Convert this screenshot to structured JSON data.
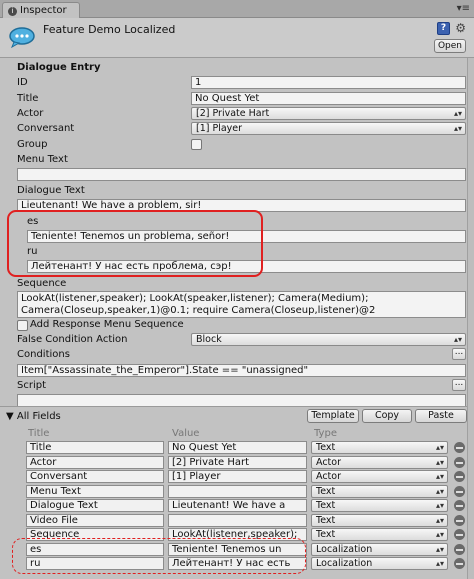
{
  "tab": {
    "title": "Inspector"
  },
  "header": {
    "object_name": "Feature Demo Localized",
    "open_label": "Open"
  },
  "entry": {
    "section_title": "Dialogue Entry",
    "labels": {
      "id": "ID",
      "title": "Title",
      "actor": "Actor",
      "conversant": "Conversant",
      "group": "Group",
      "menu_text": "Menu Text",
      "dialogue_text": "Dialogue Text",
      "es": "es",
      "ru": "ru",
      "sequence": "Sequence",
      "add_response": "Add Response Menu Sequence",
      "false_condition": "False Condition Action",
      "conditions": "Conditions",
      "script": "Script"
    },
    "values": {
      "id": "1",
      "title": "No Quest Yet",
      "actor": "[2] Private Hart",
      "conversant": "[1] Player",
      "group": false,
      "menu_text": "",
      "dialogue_text": "Lieutenant! We have a problem, sir!",
      "es": "Teniente! Tenemos un problema, señor!",
      "ru": "Лейтенант! У нас есть проблема, сэр!",
      "sequence_line1": "LookAt(listener,speaker); LookAt(speaker,listener); Camera(Medium);",
      "sequence_line2": "Camera(Closeup,speaker,1)@0.1; require Camera(Closeup,listener)@2",
      "add_response_checked": false,
      "false_condition": "Block",
      "conditions": "Item[\"Assassinate_the_Emperor\"].State == \"unassigned\"",
      "script": ""
    }
  },
  "all_fields": {
    "title": "All Fields",
    "buttons": {
      "template": "Template",
      "copy": "Copy",
      "paste": "Paste"
    },
    "columns": {
      "title": "Title",
      "value": "Value",
      "type": "Type"
    },
    "rows": [
      {
        "title": "Title",
        "value": "No Quest Yet",
        "type": "Text"
      },
      {
        "title": "Actor",
        "value": "[2] Private Hart",
        "type": "Actor"
      },
      {
        "title": "Conversant",
        "value": "[1] Player",
        "type": "Actor"
      },
      {
        "title": "Menu Text",
        "value": "",
        "type": "Text"
      },
      {
        "title": "Dialogue Text",
        "value": "Lieutenant! We have a",
        "type": "Text"
      },
      {
        "title": "Video File",
        "value": "",
        "type": "Text"
      },
      {
        "title": "Sequence",
        "value": "LookAt(listener,speaker);",
        "type": "Text"
      },
      {
        "title": "es",
        "value": "Teniente! Tenemos un",
        "type": "Localization"
      },
      {
        "title": "ru",
        "value": "Лейтенант! У нас есть",
        "type": "Localization"
      }
    ]
  },
  "colors": {
    "highlight": "#e02020",
    "panel": "#c2c2c2"
  }
}
